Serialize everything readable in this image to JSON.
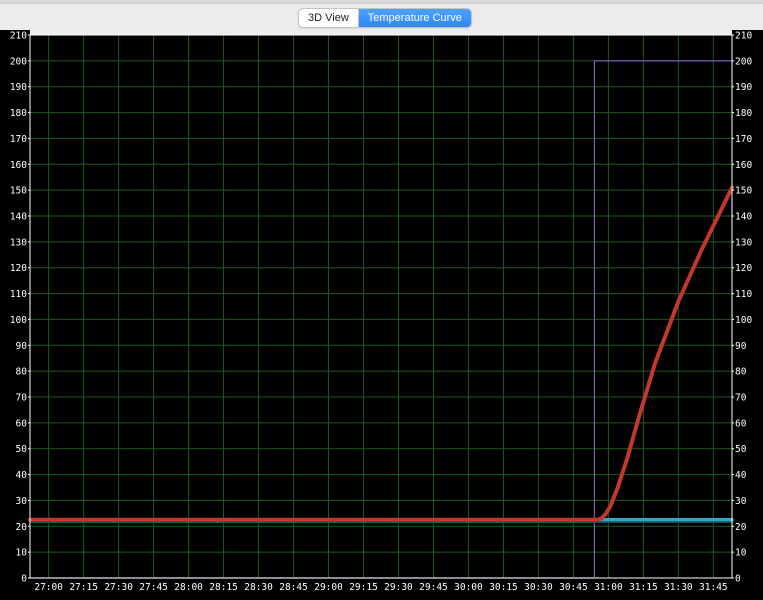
{
  "toolbar": {
    "tabs": [
      {
        "label": "3D View",
        "active": false
      },
      {
        "label": "Temperature Curve",
        "active": true
      }
    ]
  },
  "chart_data": {
    "type": "line",
    "title": "",
    "xlabel": "",
    "ylabel": "",
    "grid": true,
    "background": "#000000",
    "grid_color": "#1f5a1f",
    "xlim_seconds": [
      1612,
      1913
    ],
    "ylim": [
      0,
      210
    ],
    "y_ticks": [
      0,
      10,
      20,
      30,
      40,
      50,
      60,
      70,
      80,
      90,
      100,
      110,
      120,
      130,
      140,
      150,
      160,
      170,
      180,
      190,
      200,
      210
    ],
    "y_tick_labels": [
      "0",
      "10",
      "20",
      "30",
      "40",
      "50",
      "60",
      "70",
      "80",
      "90",
      "100",
      "110",
      "120",
      "130",
      "140",
      "150",
      "160",
      "170",
      "180",
      "190",
      "200",
      "210"
    ],
    "x_ticks_seconds": [
      1620,
      1635,
      1650,
      1665,
      1680,
      1695,
      1710,
      1725,
      1740,
      1755,
      1770,
      1785,
      1800,
      1815,
      1830,
      1845,
      1860,
      1875,
      1890,
      1905
    ],
    "x_tick_labels": [
      "27:00",
      "27:15",
      "27:30",
      "27:45",
      "28:00",
      "28:15",
      "28:30",
      "28:45",
      "29:00",
      "29:15",
      "29:30",
      "29:45",
      "30:00",
      "30:15",
      "30:30",
      "30:45",
      "31:00",
      "31:15",
      "31:30",
      "31:45"
    ],
    "series": [
      {
        "color": "#7a5fb0",
        "width": 1.2,
        "x": [
          1612,
          1852,
          1852,
          1854,
          1854,
          1913
        ],
        "y": [
          0,
          0,
          0,
          0,
          200,
          200
        ]
      },
      {
        "color": "#2fa8bf",
        "width": 3.5,
        "x": [
          1612,
          1913
        ],
        "y": [
          22.5,
          22.5
        ]
      },
      {
        "color": "#18486a",
        "width": 1.2,
        "x": [
          1612,
          1913
        ],
        "y": [
          21.5,
          21.5
        ]
      },
      {
        "color": "#c0392b",
        "width": 4,
        "x": [
          1612,
          1855,
          1857,
          1859,
          1861,
          1864,
          1868,
          1873,
          1880,
          1890,
          1900,
          1913
        ],
        "y": [
          22.5,
          22.5,
          23,
          25,
          28,
          35,
          46,
          62,
          83,
          107,
          127,
          151
        ]
      }
    ]
  }
}
